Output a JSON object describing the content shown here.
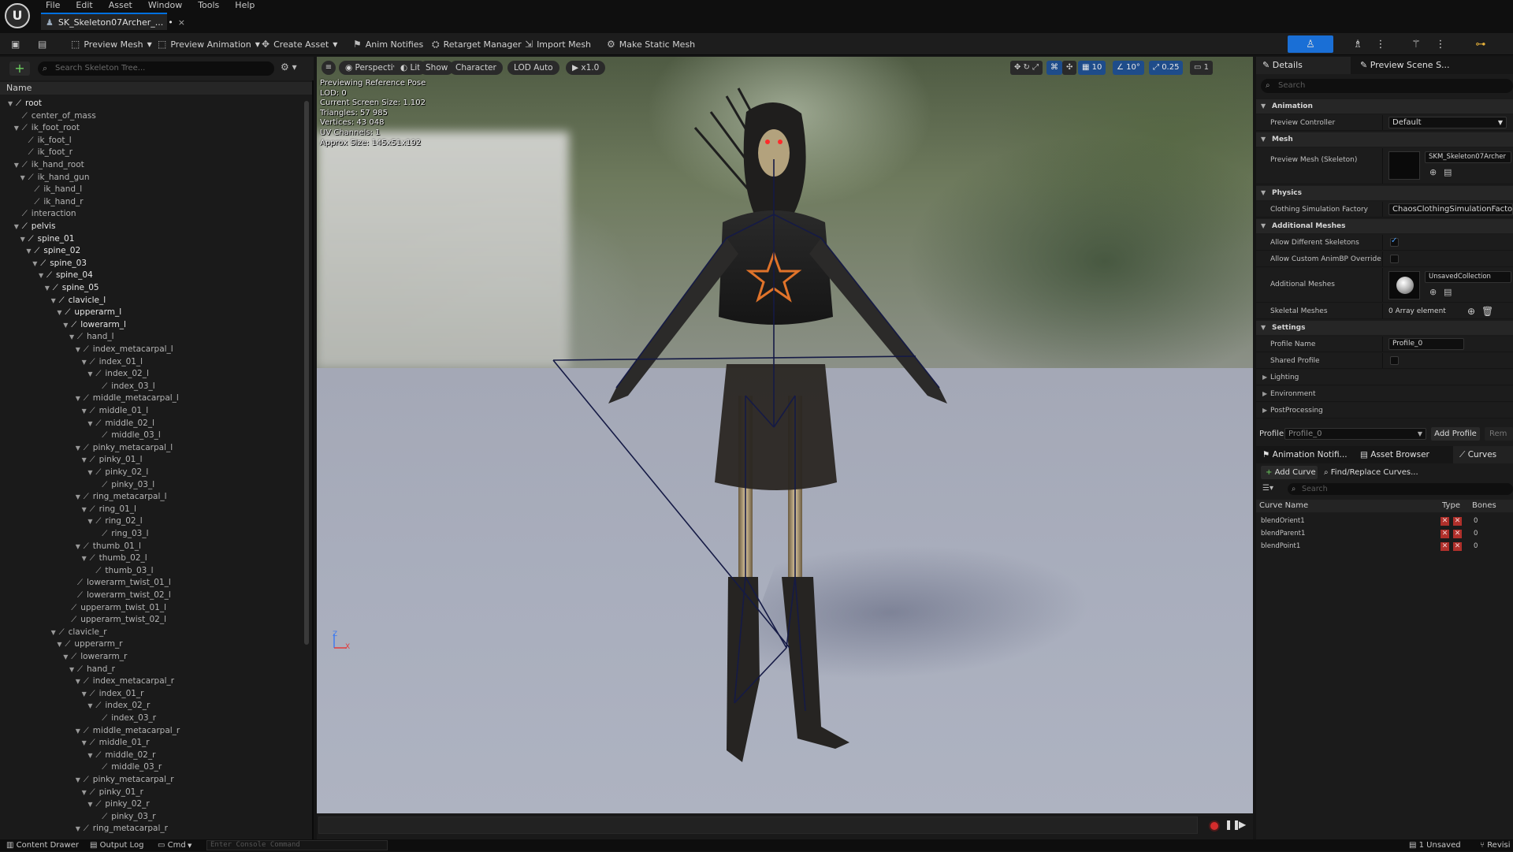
{
  "app": {
    "logo": "U",
    "document_tab": "SK_Skeleton07Archer_...",
    "tab_dirty": "•",
    "tab_close": "×"
  },
  "menu": [
    "File",
    "Edit",
    "Asset",
    "Window",
    "Tools",
    "Help"
  ],
  "toolbar": {
    "preview_mesh": "Preview Mesh",
    "preview_animation": "Preview Animation",
    "create_asset": "Create Asset",
    "anim_notifies": "Anim Notifies",
    "retarget_manager": "Retarget Manager",
    "import_mesh": "Import Mesh",
    "make_static_mesh": "Make Static Mesh"
  },
  "skeleton_tree": {
    "search_placeholder": "Search Skeleton Tree...",
    "column": "Name",
    "rows": [
      {
        "label": "root",
        "depth": 0,
        "bold": true,
        "expanded": true
      },
      {
        "label": "center_of_mass",
        "depth": 1,
        "bold": false,
        "expanded": false
      },
      {
        "label": "ik_foot_root",
        "depth": 1,
        "bold": false,
        "expanded": true
      },
      {
        "label": "ik_foot_l",
        "depth": 2,
        "bold": false,
        "expanded": false
      },
      {
        "label": "ik_foot_r",
        "depth": 2,
        "bold": false,
        "expanded": false
      },
      {
        "label": "ik_hand_root",
        "depth": 1,
        "bold": false,
        "expanded": true
      },
      {
        "label": "ik_hand_gun",
        "depth": 2,
        "bold": false,
        "expanded": true
      },
      {
        "label": "ik_hand_l",
        "depth": 3,
        "bold": false,
        "expanded": false
      },
      {
        "label": "ik_hand_r",
        "depth": 3,
        "bold": false,
        "expanded": false
      },
      {
        "label": "interaction",
        "depth": 1,
        "bold": false,
        "expanded": false
      },
      {
        "label": "pelvis",
        "depth": 1,
        "bold": true,
        "expanded": true
      },
      {
        "label": "spine_01",
        "depth": 2,
        "bold": true,
        "expanded": true
      },
      {
        "label": "spine_02",
        "depth": 3,
        "bold": true,
        "expanded": true
      },
      {
        "label": "spine_03",
        "depth": 4,
        "bold": true,
        "expanded": true
      },
      {
        "label": "spine_04",
        "depth": 5,
        "bold": true,
        "expanded": true
      },
      {
        "label": "spine_05",
        "depth": 6,
        "bold": true,
        "expanded": true
      },
      {
        "label": "clavicle_l",
        "depth": 7,
        "bold": true,
        "expanded": true
      },
      {
        "label": "upperarm_l",
        "depth": 8,
        "bold": true,
        "expanded": true
      },
      {
        "label": "lowerarm_l",
        "depth": 9,
        "bold": true,
        "expanded": true
      },
      {
        "label": "hand_l",
        "depth": 10,
        "bold": false,
        "expanded": true
      },
      {
        "label": "index_metacarpal_l",
        "depth": 11,
        "bold": false,
        "expanded": true
      },
      {
        "label": "index_01_l",
        "depth": 12,
        "bold": false,
        "expanded": true
      },
      {
        "label": "index_02_l",
        "depth": 13,
        "bold": false,
        "expanded": true
      },
      {
        "label": "index_03_l",
        "depth": 14,
        "bold": false,
        "expanded": false
      },
      {
        "label": "middle_metacarpal_l",
        "depth": 11,
        "bold": false,
        "expanded": true
      },
      {
        "label": "middle_01_l",
        "depth": 12,
        "bold": false,
        "expanded": true
      },
      {
        "label": "middle_02_l",
        "depth": 13,
        "bold": false,
        "expanded": true
      },
      {
        "label": "middle_03_l",
        "depth": 14,
        "bold": false,
        "expanded": false
      },
      {
        "label": "pinky_metacarpal_l",
        "depth": 11,
        "bold": false,
        "expanded": true
      },
      {
        "label": "pinky_01_l",
        "depth": 12,
        "bold": false,
        "expanded": true
      },
      {
        "label": "pinky_02_l",
        "depth": 13,
        "bold": false,
        "expanded": true
      },
      {
        "label": "pinky_03_l",
        "depth": 14,
        "bold": false,
        "expanded": false
      },
      {
        "label": "ring_metacarpal_l",
        "depth": 11,
        "bold": false,
        "expanded": true
      },
      {
        "label": "ring_01_l",
        "depth": 12,
        "bold": false,
        "expanded": true
      },
      {
        "label": "ring_02_l",
        "depth": 13,
        "bold": false,
        "expanded": true
      },
      {
        "label": "ring_03_l",
        "depth": 14,
        "bold": false,
        "expanded": false
      },
      {
        "label": "thumb_01_l",
        "depth": 11,
        "bold": false,
        "expanded": true
      },
      {
        "label": "thumb_02_l",
        "depth": 12,
        "bold": false,
        "expanded": true
      },
      {
        "label": "thumb_03_l",
        "depth": 13,
        "bold": false,
        "expanded": false
      },
      {
        "label": "lowerarm_twist_01_l",
        "depth": 10,
        "bold": false,
        "expanded": false
      },
      {
        "label": "lowerarm_twist_02_l",
        "depth": 10,
        "bold": false,
        "expanded": false
      },
      {
        "label": "upperarm_twist_01_l",
        "depth": 9,
        "bold": false,
        "expanded": false
      },
      {
        "label": "upperarm_twist_02_l",
        "depth": 9,
        "bold": false,
        "expanded": false
      },
      {
        "label": "clavicle_r",
        "depth": 7,
        "bold": false,
        "expanded": true
      },
      {
        "label": "upperarm_r",
        "depth": 8,
        "bold": false,
        "expanded": true
      },
      {
        "label": "lowerarm_r",
        "depth": 9,
        "bold": false,
        "expanded": true
      },
      {
        "label": "hand_r",
        "depth": 10,
        "bold": false,
        "expanded": true
      },
      {
        "label": "index_metacarpal_r",
        "depth": 11,
        "bold": false,
        "expanded": true
      },
      {
        "label": "index_01_r",
        "depth": 12,
        "bold": false,
        "expanded": true
      },
      {
        "label": "index_02_r",
        "depth": 13,
        "bold": false,
        "expanded": true
      },
      {
        "label": "index_03_r",
        "depth": 14,
        "bold": false,
        "expanded": false
      },
      {
        "label": "middle_metacarpal_r",
        "depth": 11,
        "bold": false,
        "expanded": true
      },
      {
        "label": "middle_01_r",
        "depth": 12,
        "bold": false,
        "expanded": true
      },
      {
        "label": "middle_02_r",
        "depth": 13,
        "bold": false,
        "expanded": true
      },
      {
        "label": "middle_03_r",
        "depth": 14,
        "bold": false,
        "expanded": false
      },
      {
        "label": "pinky_metacarpal_r",
        "depth": 11,
        "bold": false,
        "expanded": true
      },
      {
        "label": "pinky_01_r",
        "depth": 12,
        "bold": false,
        "expanded": true
      },
      {
        "label": "pinky_02_r",
        "depth": 13,
        "bold": false,
        "expanded": true
      },
      {
        "label": "pinky_03_r",
        "depth": 14,
        "bold": false,
        "expanded": false
      },
      {
        "label": "ring_metacarpal_r",
        "depth": 11,
        "bold": false,
        "expanded": true
      }
    ]
  },
  "viewport": {
    "perspective": "Perspective",
    "lit": "Lit",
    "show": "Show",
    "character": "Character",
    "lod": "LOD Auto",
    "play_rate": "x1.0",
    "stats": [
      "Previewing Reference Pose",
      "LOD: 0",
      "Current Screen Size: 1.102",
      "Triangles: 57 985",
      "Vertices: 43 048",
      "UV Channels: 1",
      "Approx Size: 145x51x192"
    ],
    "grid_size": "10",
    "rotation_snap": "10°",
    "scale_snap": "0.25",
    "camera_speed": "1",
    "axis_z": "Z",
    "axis_x": "X"
  },
  "details": {
    "tab_details": "Details",
    "tab_preview": "Preview Scene S...",
    "tab_close": "×",
    "search_placeholder": "Search",
    "cat_animation": "Animation",
    "preview_controller_label": "Preview Controller",
    "preview_controller_value": "Default",
    "cat_mesh": "Mesh",
    "preview_mesh_label": "Preview Mesh (Skeleton)",
    "preview_mesh_value": "SKM_Skeleton07Archer",
    "cat_physics": "Physics",
    "clothing_label": "Clothing Simulation Factory",
    "clothing_value": "ChaosClothingSimulationFactory",
    "cat_additional": "Additional Meshes",
    "allow_diff_label": "Allow Different Skeletons",
    "allow_custom_label": "Allow Custom AnimBP Override",
    "additional_meshes_label": "Additional Meshes",
    "additional_meshes_value": "UnsavedCollection",
    "skeletal_meshes_label": "Skeletal Meshes",
    "skeletal_meshes_value": "0 Array element",
    "cat_settings": "Settings",
    "profile_name_label": "Profile Name",
    "profile_name_value": "Profile_0",
    "shared_profile_label": "Shared Profile",
    "lighting": "Lighting",
    "environment": "Environment",
    "postprocessing": "PostProcessing",
    "profile_label": "Profile",
    "profile_value": "Profile_0",
    "add_profile": "Add Profile",
    "remove_profile": "Rem"
  },
  "curves": {
    "tab_anim_notifies": "Animation Notifi...",
    "tab_asset_browser": "Asset Browser",
    "tab_curves": "Curves",
    "add_curve": "Add Curve",
    "find_replace": "Find/Replace Curves...",
    "search_placeholder": "Search",
    "col_name": "Curve Name",
    "col_type": "Type",
    "col_bones": "Bones",
    "rows": [
      {
        "name": "blendOrient1",
        "bones": "0"
      },
      {
        "name": "blendParent1",
        "bones": "0"
      },
      {
        "name": "blendPoint1",
        "bones": "0"
      }
    ]
  },
  "status": {
    "content_drawer": "Content Drawer",
    "output_log": "Output Log",
    "cmd": "Cmd",
    "console_placeholder": "Enter Console Command",
    "unsaved": "1 Unsaved",
    "revision": "Revisi"
  },
  "colors": {
    "accent": "#0070e0",
    "record": "#d52c2c",
    "bone_line": "#151a45"
  }
}
